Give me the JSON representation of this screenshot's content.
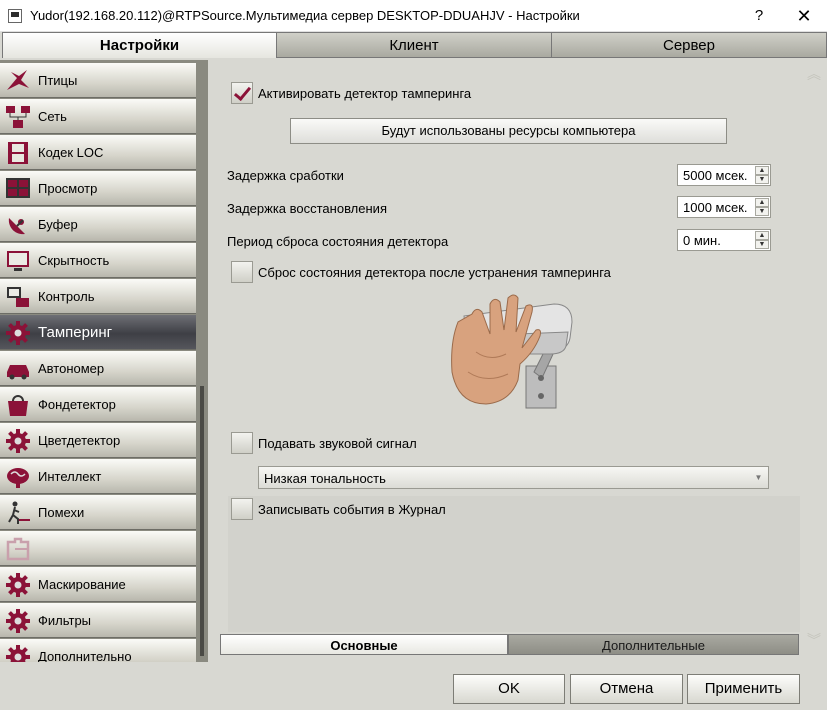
{
  "window": {
    "title": "Yudor(192.168.20.112)@RTPSource.Мультимедиа сервер DESKTOP-DDUAHJV - Настройки",
    "help_glyph": "?",
    "close_glyph": "✕"
  },
  "top_tabs": [
    {
      "label": "Настройки",
      "active": true
    },
    {
      "label": "Клиент",
      "active": false
    },
    {
      "label": "Сервер",
      "active": false
    }
  ],
  "sidebar": {
    "items": [
      {
        "label": "Птицы",
        "icon": "bird-icon"
      },
      {
        "label": "Сеть",
        "icon": "network-icon"
      },
      {
        "label": "Кодек LOC",
        "icon": "film-icon"
      },
      {
        "label": "Просмотр",
        "icon": "monitor-grid-icon"
      },
      {
        "label": "Буфер",
        "icon": "satellite-icon"
      },
      {
        "label": "Скрытность",
        "icon": "display-icon"
      },
      {
        "label": "Контроль",
        "icon": "remote-monitor-icon"
      },
      {
        "label": "Тамперинг",
        "icon": "gear-icon",
        "active": true
      },
      {
        "label": "Автономер",
        "icon": "car-icon"
      },
      {
        "label": "Фондетектор",
        "icon": "bag-icon"
      },
      {
        "label": "Цветдетектор",
        "icon": "gear-icon"
      },
      {
        "label": "Интеллект",
        "icon": "brain-icon"
      },
      {
        "label": "Помехи",
        "icon": "walker-icon"
      },
      {
        "label": "",
        "icon": "puzzle-icon",
        "disabled": true
      },
      {
        "label": "Маскирование",
        "icon": "gear-icon"
      },
      {
        "label": "Фильтры",
        "icon": "gear-icon"
      },
      {
        "label": "Дополнительно",
        "icon": "gear-icon"
      }
    ]
  },
  "tampering": {
    "activate_label": "Активировать детектор тамперинга",
    "activate_checked": true,
    "resources_button": "Будут использованы ресурсы компьютера",
    "trigger_delay_label": "Задержка сработки",
    "trigger_delay_value": "5000 мсек.",
    "restore_delay_label": "Задержка восстановления",
    "restore_delay_value": "1000 мсек.",
    "reset_period_label": "Период сброса состояния детектора",
    "reset_period_value": "0 мин.",
    "reset_after_label": "Сброс состояния детектора после устранения тамперинга",
    "reset_after_checked": false,
    "sound_label": "Подавать звуковой сигнал",
    "sound_checked": false,
    "tone_value": "Низкая тональность",
    "journal_label": "Записывать события в Журнал",
    "journal_checked": false
  },
  "bottom_tabs": {
    "main": "Основные",
    "extra": "Дополнительные"
  },
  "footer": {
    "ok": "OK",
    "cancel": "Отмена",
    "apply": "Применить"
  },
  "colors": {
    "accent": "#8b1238",
    "panel_bg": "#d8d8d2"
  }
}
